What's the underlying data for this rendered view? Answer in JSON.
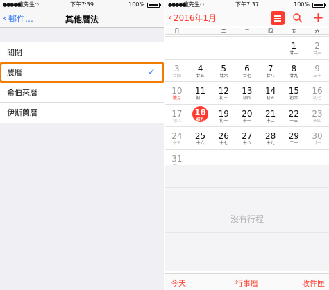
{
  "left": {
    "status": {
      "carrier": "瘋先生",
      "time": "下午7:39",
      "battery": "100%"
    },
    "nav": {
      "back_label": "郵件…",
      "title": "其他曆法"
    },
    "options": [
      {
        "label": "關閉",
        "selected": false
      },
      {
        "label": "農曆",
        "selected": true
      },
      {
        "label": "希伯來曆",
        "selected": false
      },
      {
        "label": "伊斯蘭曆",
        "selected": false
      }
    ],
    "checkmark": "✓"
  },
  "right": {
    "status": {
      "carrier": "瘋先生",
      "time": "下午7:37",
      "battery": "100%"
    },
    "nav": {
      "back_label": "2016年1月"
    },
    "weekdays": [
      "日",
      "一",
      "二",
      "三",
      "四",
      "五",
      "六"
    ],
    "weeks": [
      [
        null,
        null,
        null,
        null,
        null,
        {
          "d": "1",
          "l": "廿二"
        },
        {
          "d": "2",
          "l": "廿三"
        }
      ],
      [
        {
          "d": "3",
          "l": "廿四"
        },
        {
          "d": "4",
          "l": "廿五"
        },
        {
          "d": "5",
          "l": "廿六"
        },
        {
          "d": "6",
          "l": "廿七"
        },
        {
          "d": "7",
          "l": "廿八"
        },
        {
          "d": "8",
          "l": "廿九"
        },
        {
          "d": "9",
          "l": "三十"
        }
      ],
      [
        {
          "d": "10",
          "l": "臘月"
        },
        {
          "d": "11",
          "l": "初二"
        },
        {
          "d": "12",
          "l": "初三"
        },
        {
          "d": "13",
          "l": "初四"
        },
        {
          "d": "14",
          "l": "初五"
        },
        {
          "d": "15",
          "l": "初六"
        },
        {
          "d": "16",
          "l": "初七"
        }
      ],
      [
        {
          "d": "17",
          "l": "初八"
        },
        {
          "d": "18",
          "l": "初九"
        },
        {
          "d": "19",
          "l": "初十"
        },
        {
          "d": "20",
          "l": "十一"
        },
        {
          "d": "21",
          "l": "十二"
        },
        {
          "d": "22",
          "l": "十三"
        },
        {
          "d": "23",
          "l": "十四"
        }
      ],
      [
        {
          "d": "24",
          "l": "十五"
        },
        {
          "d": "25",
          "l": "十六"
        },
        {
          "d": "26",
          "l": "十七"
        },
        {
          "d": "27",
          "l": "十八"
        },
        {
          "d": "28",
          "l": "十九"
        },
        {
          "d": "29",
          "l": "二十"
        },
        {
          "d": "30",
          "l": "廿一"
        }
      ],
      [
        {
          "d": "31",
          "l": "廿二"
        },
        null,
        null,
        null,
        null,
        null,
        null
      ]
    ],
    "today": "18",
    "month_start_day": "10",
    "empty_message": "沒有行程",
    "toolbar": {
      "today": "今天",
      "calendars": "行事曆",
      "inbox": "收件匣"
    },
    "accent_color": "#ff3b30"
  }
}
